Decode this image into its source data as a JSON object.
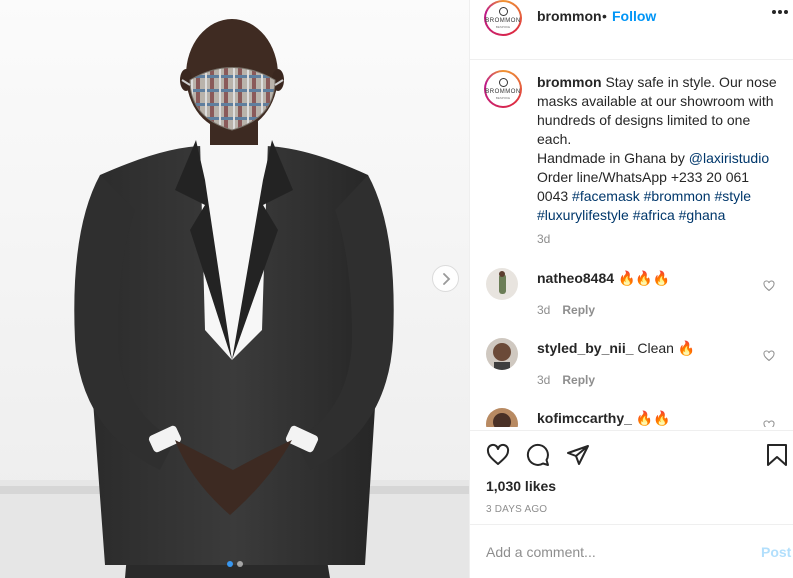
{
  "post": {
    "username": "brommon",
    "separator": "•",
    "follow_label": "Follow",
    "avatar": {
      "brand": "BROMMON",
      "sub": "BESPOKE"
    },
    "more_icon": "more-horizontal-icon"
  },
  "caption": {
    "username": "brommon",
    "text": "Stay safe in style. Our nose masks available at our showroom with hundreds of designs limited to one each.",
    "line2_prefix": "Handmade in Ghana by ",
    "mention": "@laxiristudio",
    "line3": "Order line/WhatsApp +233 20 061 0043",
    "hashtags": [
      "#facemask",
      "#brommon",
      "#style",
      "#luxurylifestyle",
      "#africa",
      "#ghana"
    ],
    "age": "3d"
  },
  "comments": [
    {
      "username": "natheo8484",
      "text": "🔥🔥🔥",
      "age": "3d",
      "reply_label": "Reply"
    },
    {
      "username": "styled_by_nii_",
      "text": "Clean 🔥",
      "age": "3d",
      "reply_label": "Reply"
    },
    {
      "username": "kofimccarthy_",
      "text": "🔥🔥",
      "age": "",
      "reply_label": ""
    }
  ],
  "actions": {
    "icons": [
      "heart-icon",
      "comment-icon",
      "share-icon",
      "bookmark-icon"
    ],
    "likes": "1,030 likes",
    "date": "3 DAYS AGO"
  },
  "add_comment": {
    "placeholder": "Add a comment...",
    "post_label": "Post"
  },
  "carousel": {
    "slides": 2,
    "active": 1
  },
  "colors": {
    "link": "#0095f6",
    "hashtag": "#00376b",
    "muted": "#8e8e8e",
    "post_disabled": "#b2dffc",
    "dot_active": "#3897f0"
  }
}
